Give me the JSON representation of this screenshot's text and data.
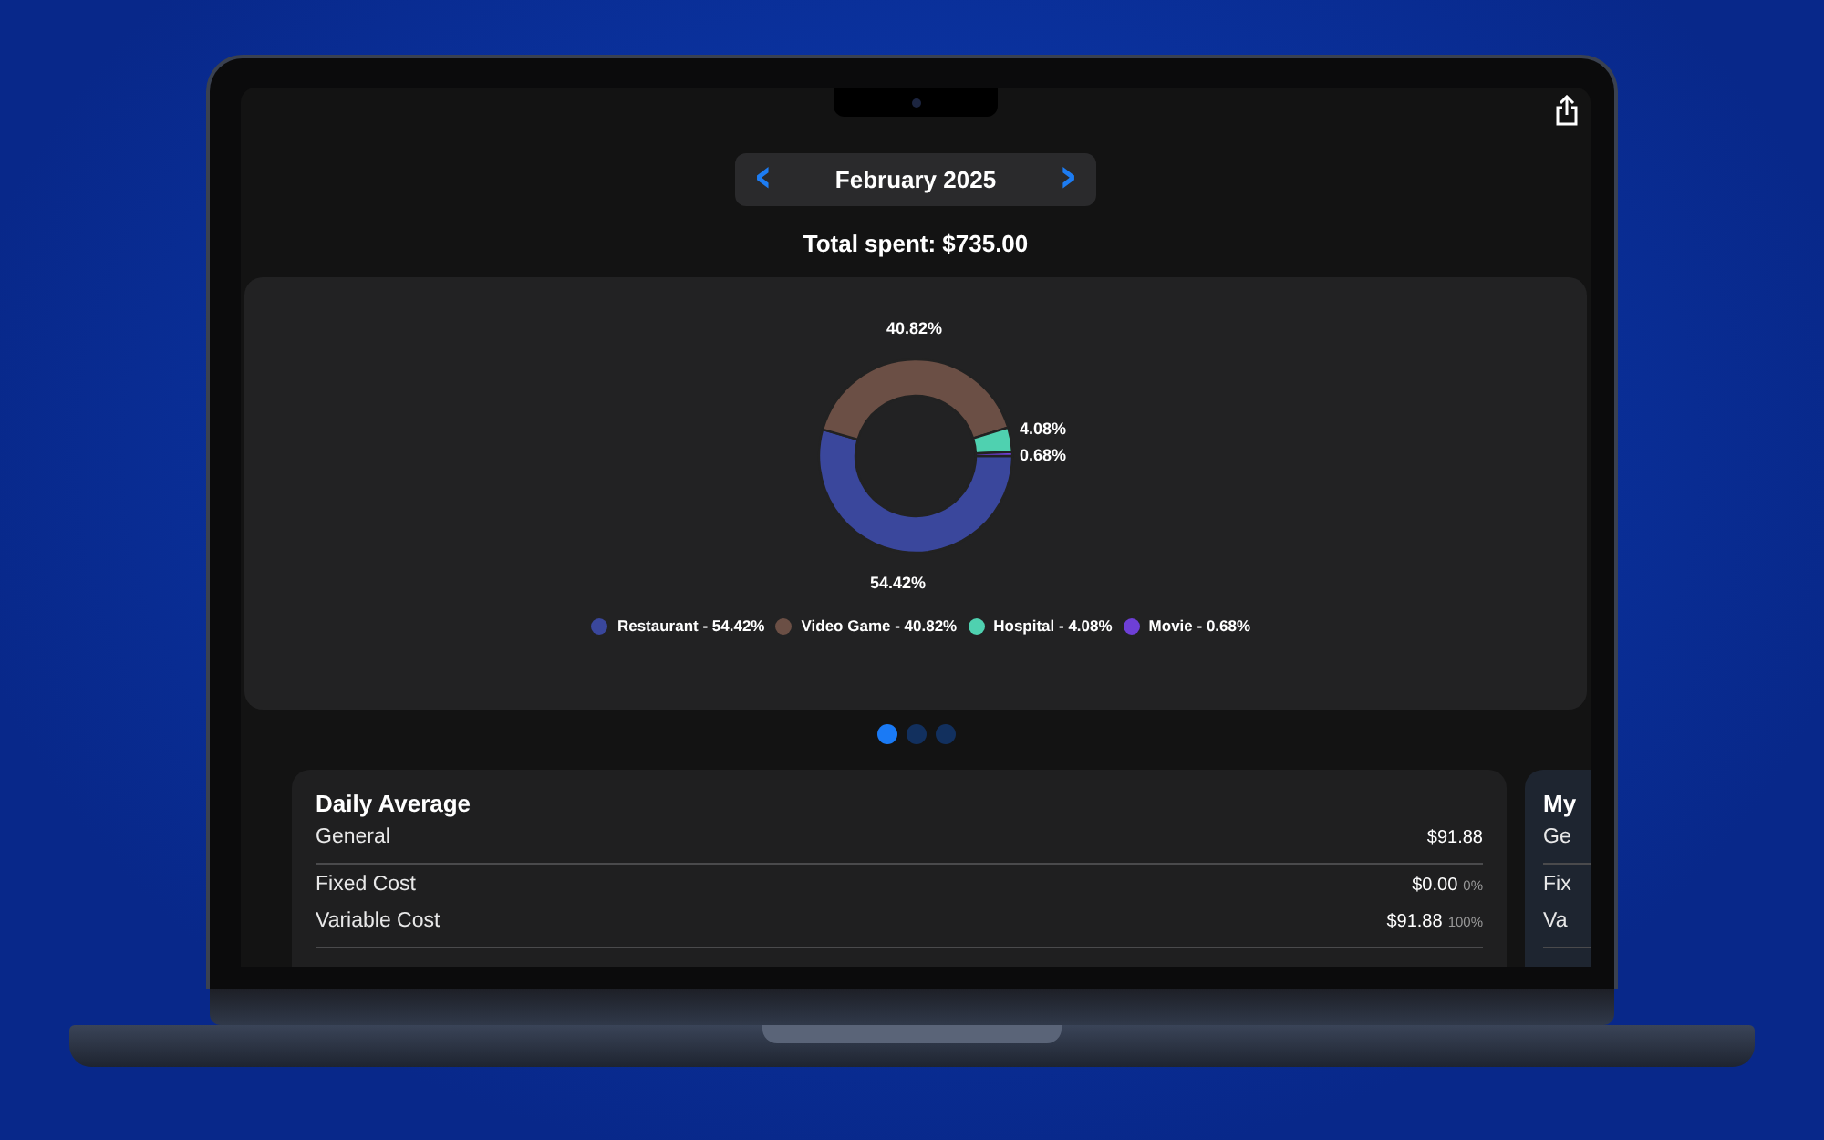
{
  "month_nav": {
    "label": "February 2025",
    "prev": "‹",
    "next": "›"
  },
  "total": "Total spent: $735.00",
  "chart_card": {
    "chart_data": {
      "type": "donut",
      "values": [
        54.42,
        40.82,
        4.08,
        0.68
      ],
      "value_labels": [
        "54.42%",
        "40.82%",
        "4.08%",
        "0.68%"
      ]
    },
    "legend": [
      {
        "label": "Restaurant - 54.42%",
        "color": "#3a479c"
      },
      {
        "label": "Video Game - 40.82%",
        "color": "#6b4f45"
      },
      {
        "label": "Hospital - 4.08%",
        "color": "#4fd1b0"
      },
      {
        "label": "Movie - 0.68%",
        "color": "#6e3fd6"
      }
    ]
  },
  "pages": [
    {
      "selected": true
    },
    {
      "selected": false
    },
    {
      "selected": false
    }
  ],
  "cards": [
    {
      "title": "Daily Average",
      "rows": [
        {
          "label": "General",
          "value": "$91.88",
          "divider": true
        },
        {
          "label": "Fixed Cost",
          "value": "$0.00",
          "percent": "0%"
        },
        {
          "label": "Variable Cost",
          "value": "$91.88",
          "percent": "100%",
          "divider": true
        }
      ]
    },
    {
      "title": "My",
      "rows": [
        {
          "label": "Ge",
          "divider": true
        },
        {
          "label": "Fix"
        },
        {
          "label": "Va",
          "divider": true
        }
      ]
    }
  ]
}
